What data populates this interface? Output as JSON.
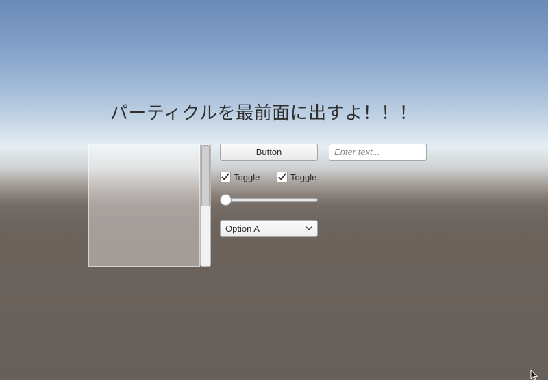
{
  "title": "パーティクルを最前面に出すよ！！！",
  "button": {
    "label": "Button"
  },
  "input": {
    "placeholder": "Enter text..."
  },
  "toggles": [
    {
      "label": "Toggle",
      "checked": true
    },
    {
      "label": "Toggle",
      "checked": true
    }
  ],
  "slider": {
    "value": 0
  },
  "scrollbar": {
    "position": 0
  },
  "dropdown": {
    "selected": "Option A"
  },
  "colors": {
    "sky_top": "#6b8ab6",
    "horizon": "#e6eef3",
    "ground": "#675f59",
    "text": "#2f2f2f"
  },
  "icons": {
    "checkmark": "check-icon",
    "dropdown_arrow": "chevron-down-icon",
    "cursor": "mouse-cursor-icon"
  }
}
